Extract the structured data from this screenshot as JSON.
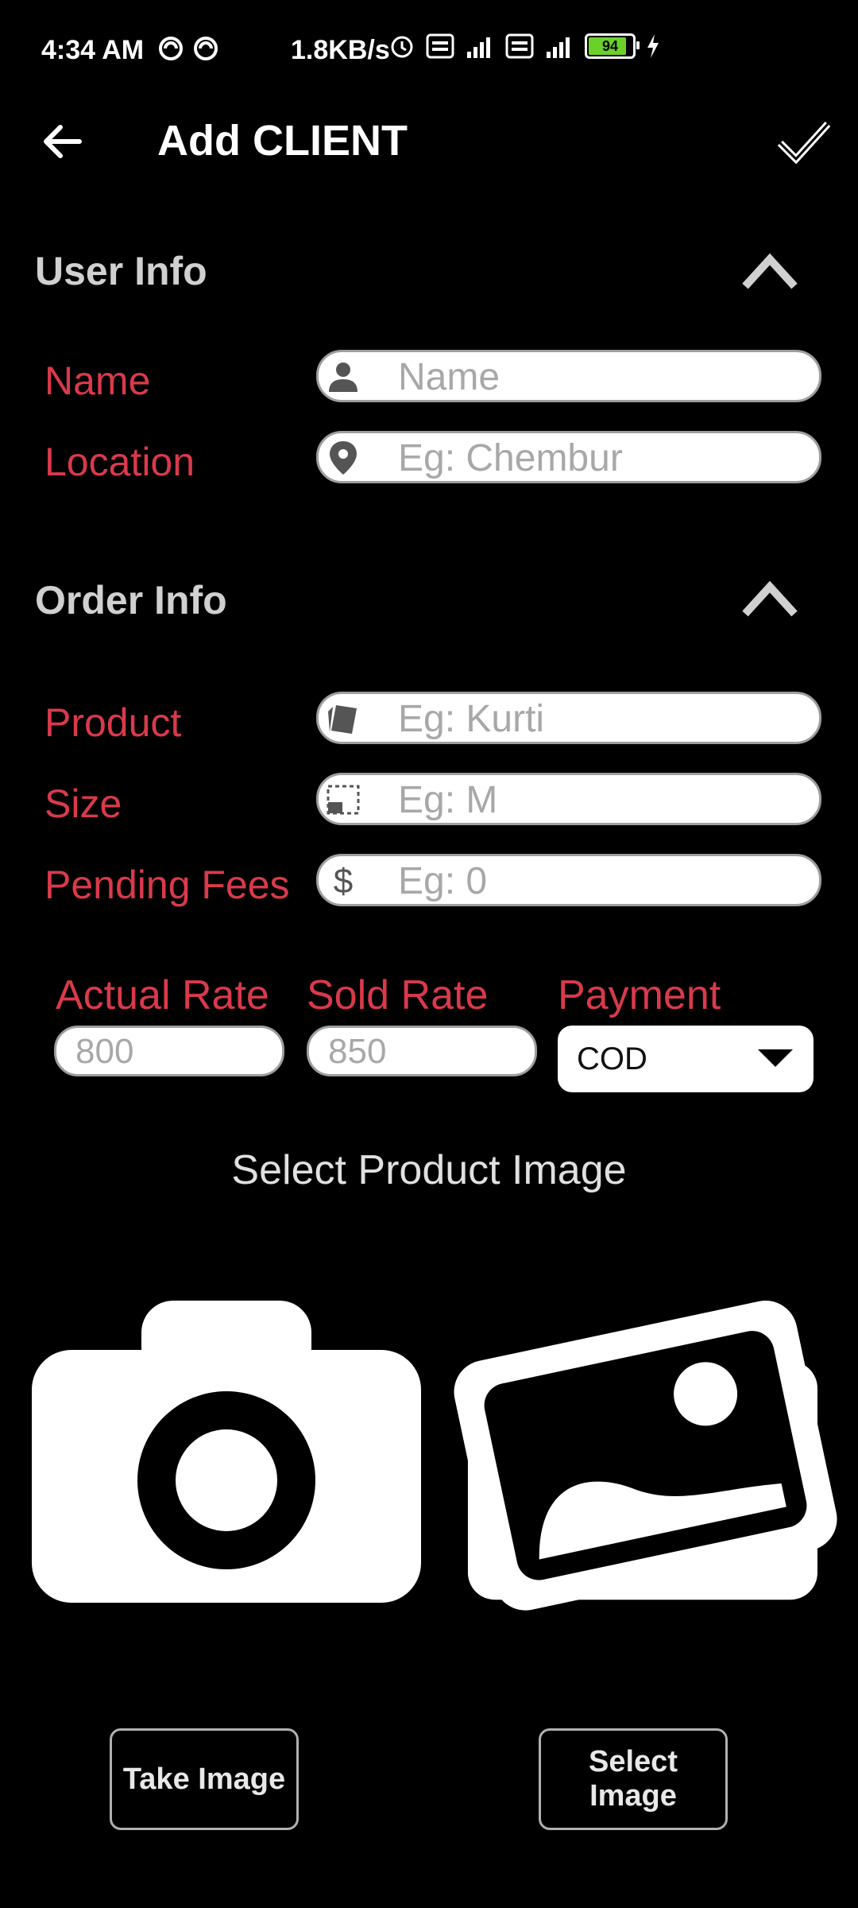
{
  "status_bar": {
    "time": "4:34 AM",
    "net_speed": "1.8KB/s",
    "battery": "94",
    "battery_level": 0.94
  },
  "app_bar": {
    "title": "Add CLIENT",
    "back_icon": "arrow-left-icon",
    "save_icon": "check-icon"
  },
  "user_info": {
    "title": "User Info",
    "name": {
      "label": "Name",
      "placeholder": "Name",
      "icon": "person-icon"
    },
    "location": {
      "label": "Location",
      "placeholder": "Eg: Chembur",
      "icon": "map-pin-icon"
    }
  },
  "order_info": {
    "title": "Order Info",
    "product": {
      "label": "Product",
      "placeholder": "Eg: Kurti",
      "icon": "tag-icon"
    },
    "size": {
      "label": "Size",
      "placeholder": "Eg: M",
      "icon": "size-icon"
    },
    "pending_fees": {
      "label": "Pending Fees",
      "placeholder": "Eg: 0",
      "icon": "dollar-icon"
    },
    "actual_rate": {
      "label": "Actual Rate",
      "placeholder": "800"
    },
    "sold_rate": {
      "label": "Sold Rate",
      "placeholder": "850"
    },
    "payment": {
      "label": "Payment",
      "value": "COD"
    }
  },
  "image_section": {
    "title": "Select Product Image",
    "camera_icon": "camera-icon",
    "gallery_icon": "gallery-icon",
    "take_button": "Take Image",
    "select_button": "Select Image"
  },
  "colors": {
    "accent": "#d93a4b",
    "background": "#000000",
    "battery": "#6bd12a"
  }
}
